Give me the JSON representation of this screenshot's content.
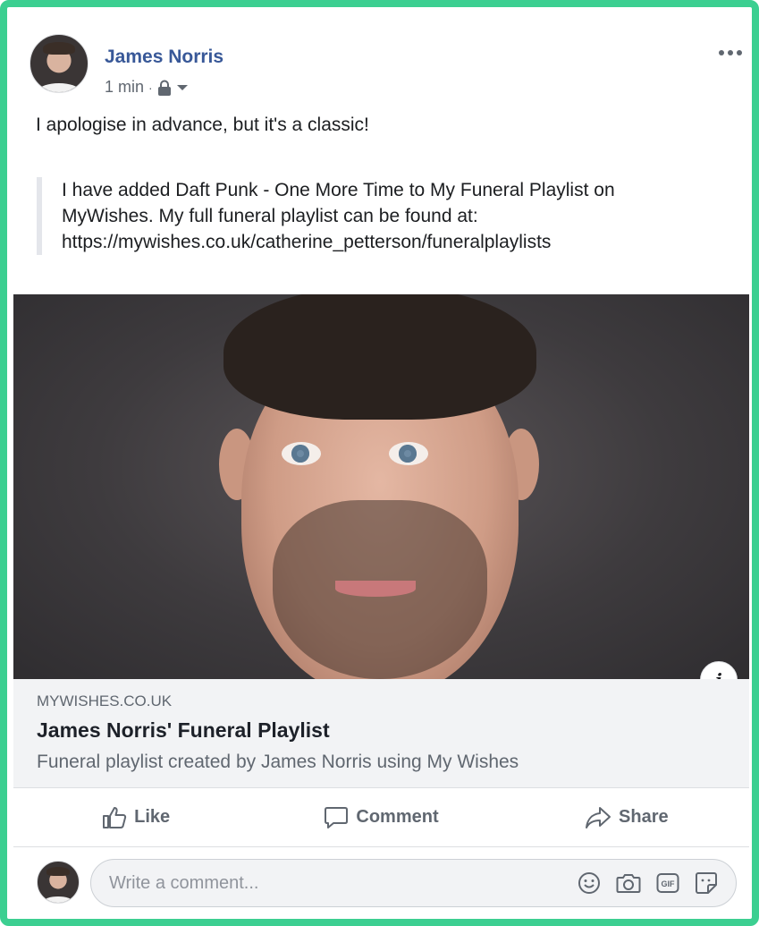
{
  "post": {
    "author": "James Norris",
    "time": "1 min",
    "separator": "·",
    "text": "I apologise in advance, but it's a classic!",
    "quote_lines": [
      "I have added Daft Punk - One More Time to My Funeral Playlist on",
      "MyWishes. My full funeral playlist can be found at:",
      "https://mywishes.co.uk/catherine_petterson/funeralplaylists"
    ]
  },
  "link_preview": {
    "domain": "MYWISHES.CO.UK",
    "title": "James Norris' Funeral Playlist",
    "description": "Funeral playlist created by James Norris using My Wishes",
    "info_glyph": "i"
  },
  "actions": {
    "like": "Like",
    "comment": "Comment",
    "share": "Share"
  },
  "comment": {
    "placeholder": "Write a comment..."
  },
  "icons": [
    "lock-icon",
    "chevron-down-icon",
    "more-icon",
    "info-icon",
    "thumbs-up-icon",
    "speech-bubble-icon",
    "share-arrow-icon",
    "smiley-icon",
    "camera-icon",
    "gif-icon",
    "sticker-icon"
  ],
  "colors": {
    "frame_border": "#3ccf91",
    "author_link": "#385898",
    "secondary_text": "#606770",
    "preview_bg": "#f2f3f5"
  }
}
